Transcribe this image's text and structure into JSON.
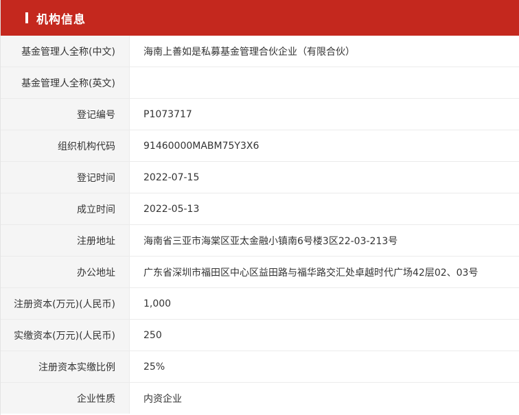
{
  "header": {
    "title": "机构信息"
  },
  "rows": [
    {
      "label": "基金管理人全称(中文)",
      "value": "海南上善如是私募基金管理合伙企业（有限合伙）"
    },
    {
      "label": "基金管理人全称(英文)",
      "value": ""
    },
    {
      "label": "登记编号",
      "value": "P1073717"
    },
    {
      "label": "组织机构代码",
      "value": "91460000MABM75Y3X6"
    },
    {
      "label": "登记时间",
      "value": "2022-07-15"
    },
    {
      "label": "成立时间",
      "value": "2022-05-13"
    },
    {
      "label": "注册地址",
      "value": "海南省三亚市海棠区亚太金融小镇南6号楼3区22-03-213号"
    },
    {
      "label": "办公地址",
      "value": "广东省深圳市福田区中心区益田路与福华路交汇处卓越时代广场42层02、03号"
    },
    {
      "label": "注册资本(万元)(人民币)",
      "value": "1,000"
    },
    {
      "label": "实缴资本(万元)(人民币)",
      "value": "250"
    },
    {
      "label": "注册资本实缴比例",
      "value": "25%"
    },
    {
      "label": "企业性质",
      "value": "内资企业"
    }
  ],
  "colors": {
    "header_bg": "#c4281e",
    "label_bg": "#f5f5f5"
  }
}
